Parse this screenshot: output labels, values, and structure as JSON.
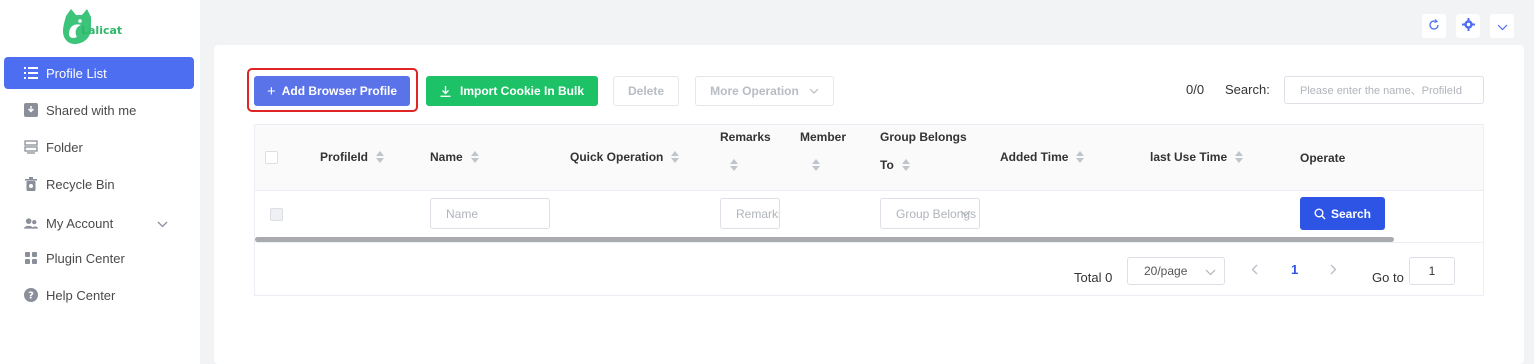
{
  "app": {
    "logo_text": "Lalicat",
    "brand_color": "#2fb86a",
    "accent_color": "#4e6ef2"
  },
  "sidebar": {
    "items": [
      {
        "label": "Profile List",
        "icon": "list-icon",
        "active": true
      },
      {
        "label": "Shared with me",
        "icon": "download-tray-icon"
      },
      {
        "label": "Folder",
        "icon": "folder-stack-icon"
      },
      {
        "label": "Recycle Bin",
        "icon": "trash-icon"
      },
      {
        "label": "My Account",
        "icon": "users-icon",
        "expandable": true
      },
      {
        "label": "Plugin Center",
        "icon": "grid-icon"
      },
      {
        "label": "Help Center",
        "icon": "help-circle-icon"
      }
    ]
  },
  "toolbar": {
    "add_label": "Add Browser Profile",
    "import_label": "Import Cookie In Bulk",
    "delete_label": "Delete",
    "more_label": "More Operation",
    "counter": "0/0",
    "search_label": "Search:",
    "search_placeholder": "Please enter the name、ProfileId"
  },
  "table": {
    "columns": {
      "profileid": "ProfileId",
      "name": "Name",
      "quick_operation": "Quick Operation",
      "remarks": "Remarks",
      "member": "Member",
      "group_line1": "Group Belongs",
      "group_line2": "To",
      "added_time": "Added Time",
      "last_use_time": "last Use Time",
      "operate": "Operate"
    },
    "filters": {
      "name_placeholder": "Name",
      "remarks_placeholder": "Remarks",
      "group_placeholder": "Group Belongs To",
      "search_button": "Search"
    }
  },
  "pagination": {
    "total": "Total 0",
    "page_size": "20/page",
    "current_page": "1",
    "goto_label": "Go to",
    "goto_value": "1"
  }
}
